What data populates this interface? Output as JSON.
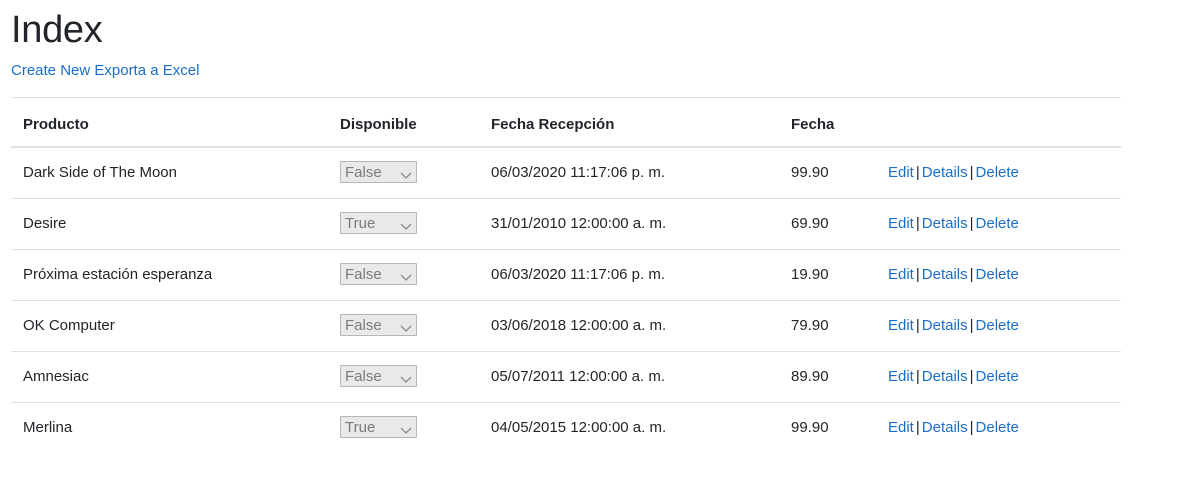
{
  "page": {
    "title": "Index",
    "links": {
      "create_new": "Create New",
      "export": "Exporta a Excel"
    }
  },
  "table": {
    "headers": [
      "Producto",
      "Disponible",
      "Fecha Recepción",
      "Fecha"
    ],
    "actions": {
      "edit": "Edit",
      "details": "Details",
      "delete": "Delete",
      "separator": "|"
    },
    "rows": [
      {
        "producto": "Dark Side of The Moon",
        "disponible": "False",
        "fecha_recepcion": "06/03/2020 11:17:06 p. m.",
        "fecha": "99.90"
      },
      {
        "producto": "Desire",
        "disponible": "True",
        "fecha_recepcion": "31/01/2010 12:00:00 a. m.",
        "fecha": "69.90"
      },
      {
        "producto": "Próxima estación esperanza",
        "disponible": "False",
        "fecha_recepcion": "06/03/2020 11:17:06 p. m.",
        "fecha": "19.90"
      },
      {
        "producto": "OK Computer",
        "disponible": "False",
        "fecha_recepcion": "03/06/2018 12:00:00 a. m.",
        "fecha": "79.90"
      },
      {
        "producto": "Amnesiac",
        "disponible": "False",
        "fecha_recepcion": "05/07/2011 12:00:00 a. m.",
        "fecha": "89.90"
      },
      {
        "producto": "Merlina",
        "disponible": "True",
        "fecha_recepcion": "04/05/2015 12:00:00 a. m.",
        "fecha": "99.90"
      }
    ]
  },
  "colors": {
    "link": "#1a6ec7",
    "text": "#212529",
    "border": "#dee2e6",
    "select_bg": "#e9e9e9",
    "select_text": "#7b7b7b"
  },
  "icons": {
    "select_arrow": "chevron-down-icon"
  }
}
